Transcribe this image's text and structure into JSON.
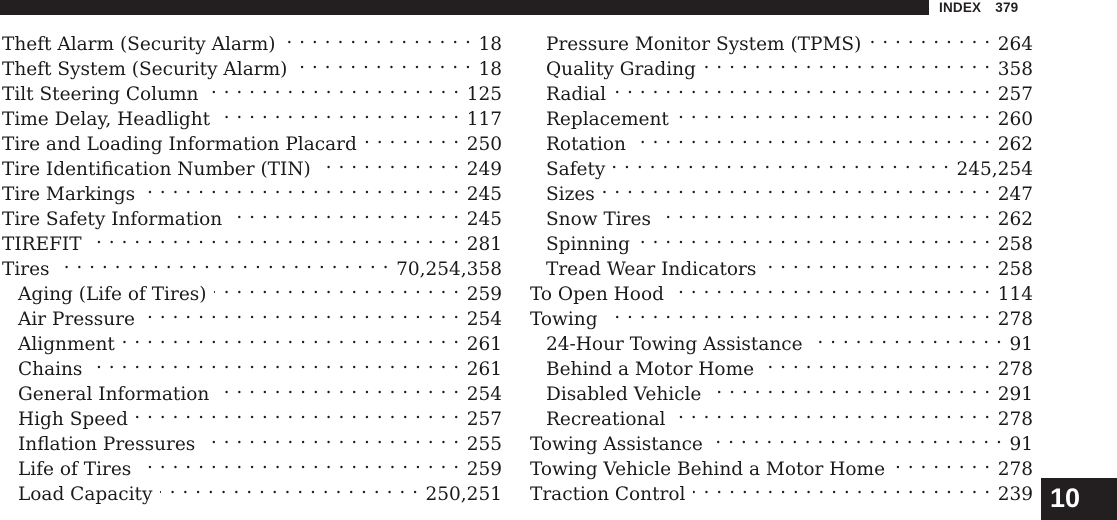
{
  "header": {
    "section_label": "INDEX",
    "page_number": "379"
  },
  "section_tab": {
    "number": "10"
  },
  "columns": {
    "left": [
      {
        "title": "Theft Alarm (Security Alarm)",
        "page": "18",
        "level": 0
      },
      {
        "title": "Theft System (Security Alarm)",
        "page": "18",
        "level": 0
      },
      {
        "title": "Tilt Steering Column",
        "page": "125",
        "level": 0
      },
      {
        "title": "Time Delay, Headlight",
        "page": "117",
        "level": 0
      },
      {
        "title": "Tire and Loading Information Placard",
        "page": "250",
        "level": 0
      },
      {
        "title": "Tire Identification Number (TIN)",
        "page": "249",
        "level": 0
      },
      {
        "title": "Tire Markings",
        "page": "245",
        "level": 0
      },
      {
        "title": "Tire Safety Information",
        "page": "245",
        "level": 0
      },
      {
        "title": "TIREFIT",
        "page": "281",
        "level": 0
      },
      {
        "title": "Tires",
        "page": "70,254,358",
        "level": 0
      },
      {
        "title": "Aging (Life of Tires)",
        "page": "259",
        "level": 1
      },
      {
        "title": "Air Pressure",
        "page": "254",
        "level": 1
      },
      {
        "title": "Alignment",
        "page": "261",
        "level": 1
      },
      {
        "title": "Chains",
        "page": "261",
        "level": 1
      },
      {
        "title": "General Information",
        "page": "254",
        "level": 1
      },
      {
        "title": "High Speed",
        "page": "257",
        "level": 1
      },
      {
        "title": "Inflation Pressures",
        "page": "255",
        "level": 1
      },
      {
        "title": "Life of Tires",
        "page": "259",
        "level": 1
      },
      {
        "title": "Load Capacity",
        "page": "250,251",
        "level": 1
      }
    ],
    "right": [
      {
        "title": "Pressure Monitor System (TPMS)",
        "page": "264",
        "level": 1
      },
      {
        "title": "Quality Grading",
        "page": "358",
        "level": 1
      },
      {
        "title": "Radial",
        "page": "257",
        "level": 1
      },
      {
        "title": "Replacement",
        "page": "260",
        "level": 1
      },
      {
        "title": "Rotation",
        "page": "262",
        "level": 1
      },
      {
        "title": "Safety",
        "page": "245,254",
        "level": 1
      },
      {
        "title": "Sizes",
        "page": "247",
        "level": 1
      },
      {
        "title": "Snow Tires",
        "page": "262",
        "level": 1
      },
      {
        "title": "Spinning",
        "page": "258",
        "level": 1
      },
      {
        "title": "Tread Wear Indicators",
        "page": "258",
        "level": 1
      },
      {
        "title": "To Open Hood",
        "page": "114",
        "level": 0
      },
      {
        "title": "Towing",
        "page": "278",
        "level": 0
      },
      {
        "title": "24-Hour Towing Assistance",
        "page": "91",
        "level": 1
      },
      {
        "title": "Behind a Motor Home",
        "page": "278",
        "level": 1
      },
      {
        "title": "Disabled Vehicle",
        "page": "291",
        "level": 1
      },
      {
        "title": "Recreational",
        "page": "278",
        "level": 1
      },
      {
        "title": "Towing Assistance",
        "page": "91",
        "level": 0
      },
      {
        "title": "Towing Vehicle Behind a Motor Home",
        "page": "278",
        "level": 0
      },
      {
        "title": "Traction Control",
        "page": "239",
        "level": 0
      }
    ]
  }
}
